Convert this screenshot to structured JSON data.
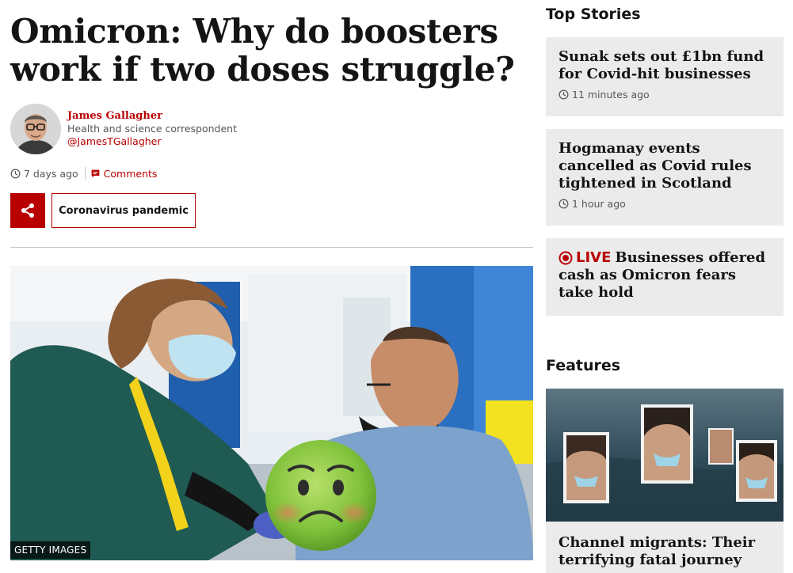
{
  "article": {
    "headline": "Omicron: Why do boosters work if two doses struggle?",
    "author": {
      "name": "James Gallagher",
      "role": "Health and science correspondent",
      "handle": "@JamesTGallagher"
    },
    "timestamp": "7 days ago",
    "comments_label": "Comments",
    "topic_label": "Coronavirus pandemic",
    "image_credit": "GETTY IMAGES"
  },
  "sidebar": {
    "top_stories_title": "Top Stories",
    "stories": [
      {
        "title": "Sunak sets out £1bn fund for Covid-hit businesses",
        "time": "11 minutes ago"
      },
      {
        "title": "Hogmanay events cancelled as Covid rules tightened in Scotland",
        "time": "1 hour ago"
      },
      {
        "live_label": "LIVE",
        "title": "Businesses offered cash as Omicron fears take hold"
      }
    ],
    "features_title": "Features",
    "feature": {
      "title": "Channel migrants: Their terrifying fatal journey"
    }
  },
  "colors": {
    "accent": "#b80000",
    "card_bg": "#ebebeb",
    "meta_text": "#545658"
  },
  "icons": {
    "clock": "clock-icon",
    "comments": "comment-icon",
    "share": "share-icon",
    "live": "live-dot-icon",
    "emoji_overlay": "nauseated-face-emoji"
  }
}
